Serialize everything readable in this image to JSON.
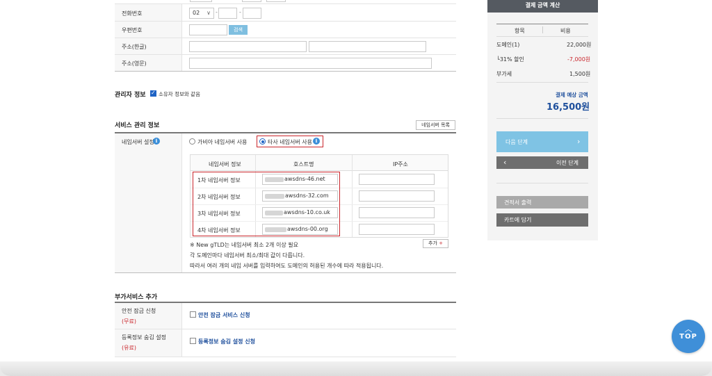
{
  "form": {
    "phone_label": "전화번호",
    "phone_prefix": "02",
    "phone_dash": "-",
    "zip_label": "우편번호",
    "zip_search_button": "검색",
    "address_ko_label": "주소(한글)",
    "address_en_label": "주소(영문)"
  },
  "admin": {
    "title": "관리자 정보",
    "same_as_owner_label": "소유자 정보와 같음",
    "same_as_owner_checked": true
  },
  "service": {
    "title": "서비스 관리 정보",
    "ns_list_button": "네임서버 목록",
    "ns_setting_label": "네임서버 설정",
    "option_gabia": "가비아 네임서버 사용",
    "option_other": "타사 네임서버 사용",
    "selected_option": "other",
    "table": {
      "col_info": "네임서버 정보",
      "col_host": "호스트명",
      "col_ip": "IP주소",
      "rows": [
        {
          "label": "1차 네임서버 정보",
          "host": "awsdns-46.net"
        },
        {
          "label": "2차 네임서버 정보",
          "host": "awsdns-32.com"
        },
        {
          "label": "3차 네임서버 정보",
          "host": "awsdns-10.co.uk"
        },
        {
          "label": "4차 네임서버 정보",
          "host": "awsdns-00.org"
        }
      ]
    },
    "add_button": "추가",
    "add_plus": "+",
    "note1": "※ New gTLD는 네임서버 최소 2개 이상 필요",
    "note2": "각 도메인마다 네임서버 최소/최대 값이 다릅니다.",
    "note3": "따라서 여러 개의 네임 서버를 입력하여도 도메인의 허용된 개수에 따라 적용됩니다."
  },
  "extra": {
    "title": "부가서비스 추가",
    "lock_label": "안전 잠금 신청",
    "lock_price": "(무료)",
    "lock_option": "안전 잠금 서비스 신청",
    "privacy_label": "등록정보 숨김 설정",
    "privacy_price": "(유료)",
    "privacy_option": "등록정보 숨김 설정 신청"
  },
  "sidebar": {
    "title": "결제 금액 계산",
    "col_item": "항목",
    "col_cost": "비용",
    "rows": [
      {
        "item": "도메인(1)",
        "cost": "22,000원"
      },
      {
        "item": "└31% 할인",
        "cost": "-7,000원"
      },
      {
        "item": "부가세",
        "cost": "1,500원"
      }
    ],
    "expected_label": "결제 예상 금액",
    "expected_amount": "16,500원",
    "next_button": "다음 단계",
    "prev_button": "이전 단계",
    "quote_button": "견적서 출력",
    "cart_button": "카트에 담기"
  },
  "top_button": "TOP",
  "colors": {
    "accent": "#1e63c5",
    "discount_red": "#c9252b",
    "next_button": "#7fc3e4",
    "dark_button": "#6e6e6e",
    "top_button": "#3f8fd8"
  }
}
